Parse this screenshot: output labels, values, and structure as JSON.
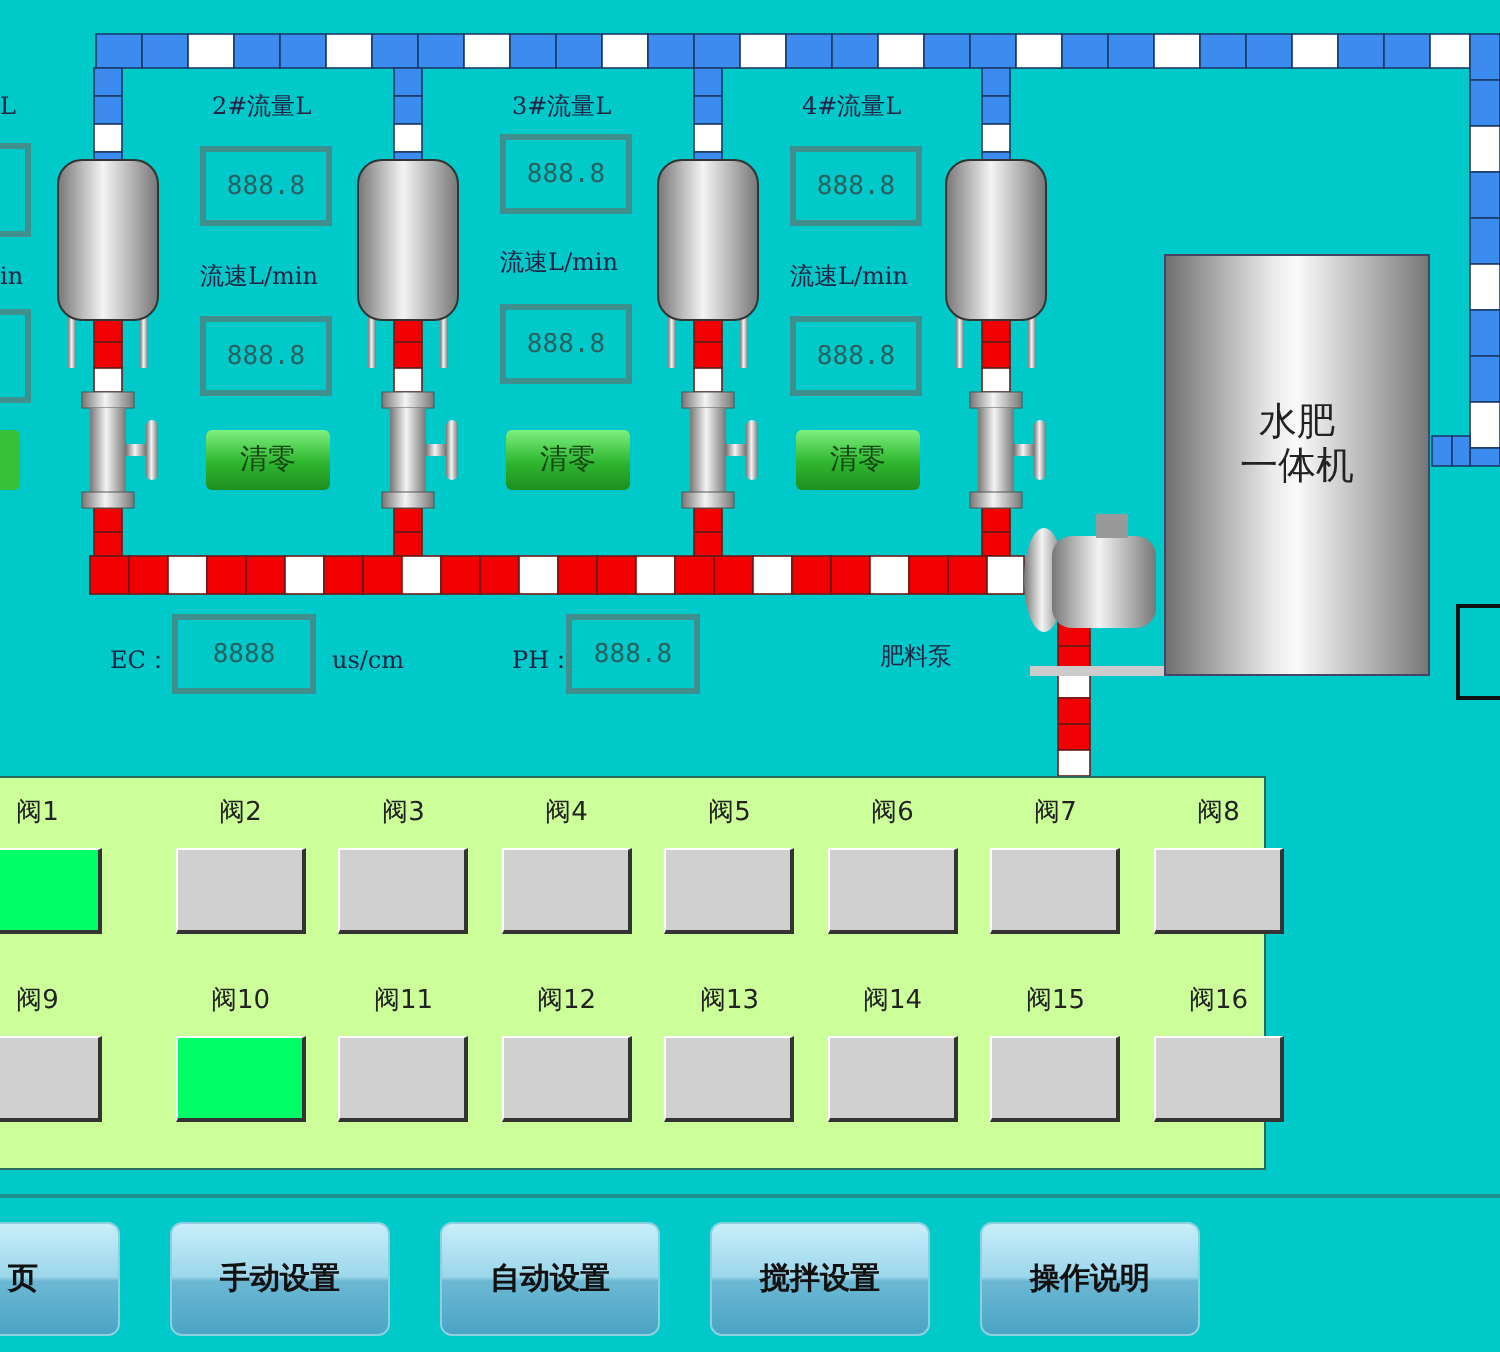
{
  "partial_meter": {
    "flow_label": "L",
    "rate_label": "in"
  },
  "meters": [
    {
      "flow_label": "2#流量L",
      "flow_value": "888.8",
      "rate_label": "流速L/min",
      "rate_value": "888.8",
      "reset_button": "清零"
    },
    {
      "flow_label": "3#流量L",
      "flow_value": "888.8",
      "rate_label": "流速L/min",
      "rate_value": "888.8",
      "reset_button": "清零"
    },
    {
      "flow_label": "4#流量L",
      "flow_value": "888.8",
      "rate_label": "流速L/min",
      "rate_value": "888.8",
      "reset_button": "清零"
    }
  ],
  "machine_label": [
    "水肥",
    "一体机"
  ],
  "ec": {
    "label": "EC：",
    "value": "8888",
    "unit": "us/cm"
  },
  "ph": {
    "label": "PH：",
    "value": "888.8"
  },
  "pump_label": "肥料泵",
  "valves": [
    {
      "label": "阀1",
      "open": true
    },
    {
      "label": "阀2",
      "open": false
    },
    {
      "label": "阀3",
      "open": false
    },
    {
      "label": "阀4",
      "open": false
    },
    {
      "label": "阀5",
      "open": false
    },
    {
      "label": "阀6",
      "open": false
    },
    {
      "label": "阀7",
      "open": false
    },
    {
      "label": "阀8",
      "open": false
    },
    {
      "label": "阀9",
      "open": false
    },
    {
      "label": "阀10",
      "open": true
    },
    {
      "label": "阀11",
      "open": false
    },
    {
      "label": "阀12",
      "open": false
    },
    {
      "label": "阀13",
      "open": false
    },
    {
      "label": "阀14",
      "open": false
    },
    {
      "label": "阀15",
      "open": false
    },
    {
      "label": "阀16",
      "open": false
    }
  ],
  "nav_buttons": [
    "页",
    "手动设置",
    "自动设置",
    "搅拌设置",
    "操作说明"
  ]
}
